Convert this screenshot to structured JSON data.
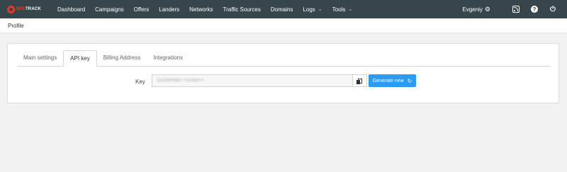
{
  "logo": {
    "prefix": "BEE",
    "suffix": "TRACK"
  },
  "nav": [
    {
      "label": "Dashboard",
      "dropdown": false
    },
    {
      "label": "Campaigns",
      "dropdown": false
    },
    {
      "label": "Offers",
      "dropdown": false
    },
    {
      "label": "Landers",
      "dropdown": false
    },
    {
      "label": "Networks",
      "dropdown": false
    },
    {
      "label": "Traffic Sources",
      "dropdown": false
    },
    {
      "label": "Domains",
      "dropdown": false
    },
    {
      "label": "Logs",
      "dropdown": true
    },
    {
      "label": "Tools",
      "dropdown": true
    }
  ],
  "user": {
    "name": "Evgeniy"
  },
  "icons": {
    "user_settings": "gear-icon",
    "feed": "rss-icon",
    "help": "help-icon",
    "logout": "power-icon"
  },
  "breadcrumb": "Profile",
  "tabs": [
    {
      "label": "Main settings",
      "active": false
    },
    {
      "label": "API key",
      "active": true
    },
    {
      "label": "Billing Address",
      "active": false
    },
    {
      "label": "Integrations",
      "active": false
    }
  ],
  "api_key": {
    "label": "Key",
    "value": "S2LmbPNkt7TYvGNXFY",
    "generate_label": "Generate new"
  },
  "colors": {
    "topbar": "#37464c",
    "primary_button": "#2b9bf3",
    "logo_accent": "#e23b2e"
  }
}
